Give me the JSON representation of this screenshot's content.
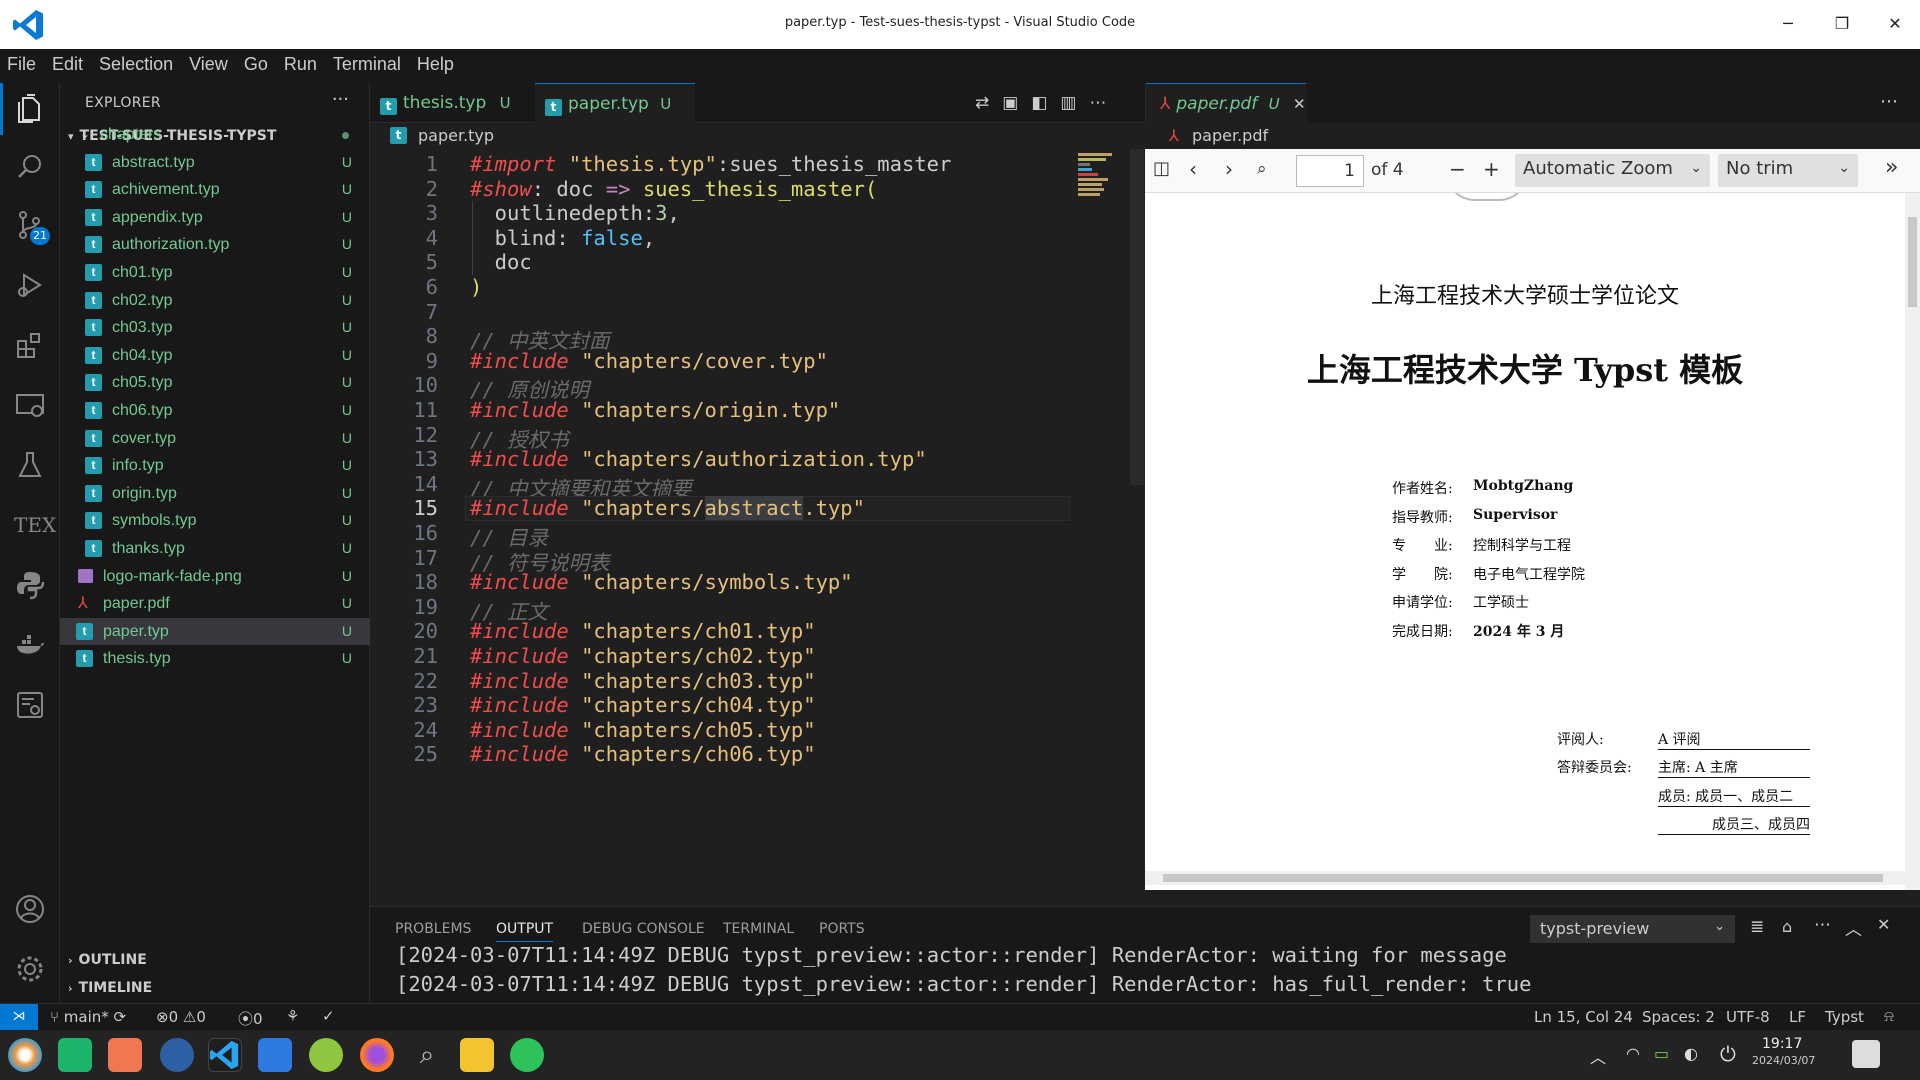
{
  "window": {
    "title": "paper.typ - Test-sues-thesis-typst - Visual Studio Code",
    "minimize": "─",
    "restore": "❐",
    "close": "✕"
  },
  "menu": [
    "File",
    "Edit",
    "Selection",
    "View",
    "Go",
    "Run",
    "Terminal",
    "Help"
  ],
  "activity": {
    "scm_badge": "21",
    "tex_label": "TEX"
  },
  "explorer": {
    "title": "EXPLORER",
    "more": "···",
    "root": "TEST-SUES-THESIS-TYPST",
    "folder": "chapters",
    "files": [
      {
        "name": "abstract.typ",
        "status": "U"
      },
      {
        "name": "achivement.typ",
        "status": "U"
      },
      {
        "name": "appendix.typ",
        "status": "U"
      },
      {
        "name": "authorization.typ",
        "status": "U"
      },
      {
        "name": "ch01.typ",
        "status": "U"
      },
      {
        "name": "ch02.typ",
        "status": "U"
      },
      {
        "name": "ch03.typ",
        "status": "U"
      },
      {
        "name": "ch04.typ",
        "status": "U"
      },
      {
        "name": "ch05.typ",
        "status": "U"
      },
      {
        "name": "ch06.typ",
        "status": "U"
      },
      {
        "name": "cover.typ",
        "status": "U"
      },
      {
        "name": "info.typ",
        "status": "U"
      },
      {
        "name": "origin.typ",
        "status": "U"
      },
      {
        "name": "symbols.typ",
        "status": "U"
      },
      {
        "name": "thanks.typ",
        "status": "U"
      }
    ],
    "root_files": [
      {
        "name": "logo-mark-fade.png",
        "status": "U"
      },
      {
        "name": "paper.pdf",
        "status": "U"
      },
      {
        "name": "paper.typ",
        "status": "U"
      },
      {
        "name": "thesis.typ",
        "status": "U"
      }
    ],
    "outline": "OUTLINE",
    "timeline": "TIMELINE"
  },
  "editor": {
    "tabs": [
      {
        "name": "thesis.typ",
        "status": "U"
      },
      {
        "name": "paper.typ",
        "status": "U",
        "close": "✕"
      }
    ],
    "breadcrumb": "paper.typ",
    "line_numbers": [
      "1",
      "2",
      "3",
      "4",
      "5",
      "6",
      "7",
      "8",
      "9",
      "10",
      "11",
      "12",
      "13",
      "14",
      "15",
      "16",
      "17",
      "18",
      "19",
      "20",
      "21",
      "22",
      "23",
      "24",
      "25"
    ],
    "lines": [
      [
        {
          "t": "#import",
          "c": "kw"
        },
        {
          "t": " "
        },
        {
          "t": "\"thesis.typ\"",
          "c": "str"
        },
        {
          "t": ":sues_thesis_master"
        }
      ],
      [
        {
          "t": "#show",
          "c": "kw"
        },
        {
          "t": ": doc "
        },
        {
          "t": "=>",
          "c": "op"
        },
        {
          "t": " "
        },
        {
          "t": "sues_thesis_master(",
          "c": "fn"
        }
      ],
      [
        {
          "t": "  outlinedepth:"
        },
        {
          "t": "3",
          "c": "num"
        },
        {
          "t": ","
        }
      ],
      [
        {
          "t": "  blind: "
        },
        {
          "t": "false",
          "c": "bool"
        },
        {
          "t": ","
        }
      ],
      [
        {
          "t": "  doc"
        }
      ],
      [
        {
          "t": ")",
          "c": "fn"
        }
      ],
      [
        {
          "t": ""
        }
      ],
      [
        {
          "t": "// 中英文封面",
          "c": "cm"
        }
      ],
      [
        {
          "t": "#include",
          "c": "kw"
        },
        {
          "t": " "
        },
        {
          "t": "\"chapters/cover.typ\"",
          "c": "str"
        }
      ],
      [
        {
          "t": "// 原创说明",
          "c": "cm"
        }
      ],
      [
        {
          "t": "#include",
          "c": "kw"
        },
        {
          "t": " "
        },
        {
          "t": "\"chapters/origin.typ\"",
          "c": "str"
        }
      ],
      [
        {
          "t": "// 授权书",
          "c": "cm"
        }
      ],
      [
        {
          "t": "#include",
          "c": "kw"
        },
        {
          "t": " "
        },
        {
          "t": "\"chapters/authorization.typ\"",
          "c": "str"
        }
      ],
      [
        {
          "t": "// 中文摘要和英文摘要",
          "c": "cm"
        }
      ],
      [
        {
          "t": "#include",
          "c": "kw"
        },
        {
          "t": " "
        },
        {
          "t": "\"chapters/",
          "c": "str"
        },
        {
          "t": "abstract",
          "c": "str hl"
        },
        {
          "t": ".typ\"",
          "c": "str"
        }
      ],
      [
        {
          "t": "// 目录",
          "c": "cm"
        }
      ],
      [
        {
          "t": "// 符号说明表",
          "c": "cm"
        }
      ],
      [
        {
          "t": "#include",
          "c": "kw"
        },
        {
          "t": " "
        },
        {
          "t": "\"chapters/symbols.typ\"",
          "c": "str"
        }
      ],
      [
        {
          "t": "// 正文",
          "c": "cm"
        }
      ],
      [
        {
          "t": "#include",
          "c": "kw"
        },
        {
          "t": " "
        },
        {
          "t": "\"chapters/ch01.typ\"",
          "c": "str"
        }
      ],
      [
        {
          "t": "#include",
          "c": "kw"
        },
        {
          "t": " "
        },
        {
          "t": "\"chapters/ch02.typ\"",
          "c": "str"
        }
      ],
      [
        {
          "t": "#include",
          "c": "kw"
        },
        {
          "t": " "
        },
        {
          "t": "\"chapters/ch03.typ\"",
          "c": "str"
        }
      ],
      [
        {
          "t": "#include",
          "c": "kw"
        },
        {
          "t": " "
        },
        {
          "t": "\"chapters/ch04.typ\"",
          "c": "str"
        }
      ],
      [
        {
          "t": "#include",
          "c": "kw"
        },
        {
          "t": " "
        },
        {
          "t": "\"chapters/ch05.typ\"",
          "c": "str"
        }
      ],
      [
        {
          "t": "#include",
          "c": "kw"
        },
        {
          "t": " "
        },
        {
          "t": "\"chapters/ch06.typ\"",
          "c": "str"
        }
      ]
    ],
    "current_line": 15
  },
  "pdf": {
    "tab": {
      "name": "paper.pdf",
      "status": "U",
      "close": "✕"
    },
    "breadcrumb": "paper.pdf",
    "page_input": "1",
    "page_of": "of 4",
    "zoom_select": "Automatic Zoom",
    "trim_select": "No trim",
    "doc": {
      "subtitle": "上海工程技术大学硕士学位论文",
      "title": "上海工程技术大学 Typst 模板",
      "fields": [
        {
          "label": "作者姓名:",
          "value": "MobtgZhang",
          "bold": true
        },
        {
          "label": "指导教师:",
          "value": "Supervisor",
          "bold": true
        },
        {
          "label": "专　　业:",
          "value": "控制科学与工程",
          "bold": false
        },
        {
          "label": "学　　院:",
          "value": "电子电气工程学院",
          "bold": false
        },
        {
          "label": "申请学位:",
          "value": "工学硕士",
          "bold": false
        },
        {
          "label": "完成日期:",
          "value": "2024 年 3 月",
          "bold": true
        }
      ],
      "reviewer_label": "评阅人:",
      "reviewer_value": "A 评阅",
      "committee_label": "答辩委员会:",
      "committee_lines": [
        "主席: A 主席",
        "成员: 成员一、成员二",
        "成员三、成员四"
      ]
    }
  },
  "panel": {
    "tabs": [
      "PROBLEMS",
      "OUTPUT",
      "DEBUG CONSOLE",
      "TERMINAL",
      "PORTS"
    ],
    "active_tab": "OUTPUT",
    "channel": "typst-preview",
    "log": [
      "[2024-03-07T11:14:49Z DEBUG typst_preview::actor::render] RenderActor: waiting for message",
      "[2024-03-07T11:14:49Z DEBUG typst_preview::actor::render] RenderActor: has_full_render: true"
    ]
  },
  "status": {
    "branch": "main*",
    "errors": "0",
    "warnings": "0",
    "ports": "0",
    "position": "Ln 15, Col 24",
    "spaces": "Spaces: 2",
    "encoding": "UTF-8",
    "eol": "LF",
    "language": "Typst"
  },
  "taskbar": {
    "time": "19:17",
    "date": "2024/03/07"
  },
  "colors": {
    "accent": "#0078d4",
    "untracked": "#73c991",
    "typst_icon": "#239dad"
  }
}
